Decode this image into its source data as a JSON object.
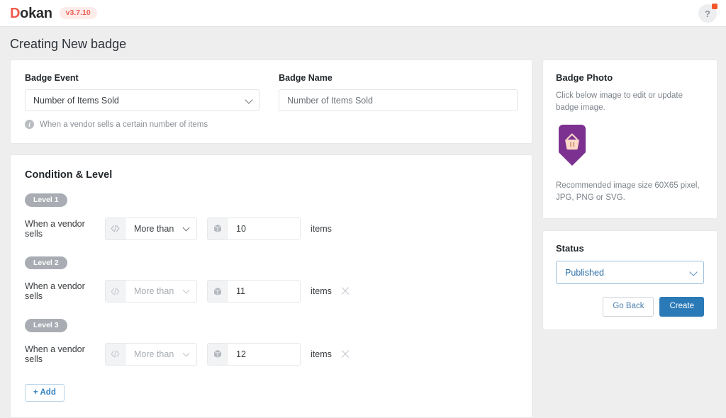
{
  "topbar": {
    "logo_d": "D",
    "logo_rest": "okan",
    "version": "v3.7.10",
    "help_label": "?"
  },
  "page": {
    "title": "Creating New badge"
  },
  "badge_info": {
    "event_label": "Badge Event",
    "event_value": "Number of Items Sold",
    "event_hint": "When a vendor sells a certain number of items",
    "name_label": "Badge Name",
    "name_value": "Number of Items Sold",
    "name_placeholder": "Number of Items Sold"
  },
  "condition": {
    "title": "Condition & Level",
    "add_label": "+ Add",
    "rows": [
      {
        "level": "Level 1",
        "prefix_text": "When a vendor sells",
        "operator": "More than",
        "amount": "10",
        "suffix_text": "items",
        "removable": false,
        "muted": false
      },
      {
        "level": "Level 2",
        "prefix_text": "When a vendor sells",
        "operator": "More than",
        "amount": "11",
        "suffix_text": "items",
        "removable": true,
        "muted": true
      },
      {
        "level": "Level 3",
        "prefix_text": "When a vendor sells",
        "operator": "More than",
        "amount": "12",
        "suffix_text": "items",
        "removable": true,
        "muted": true
      }
    ]
  },
  "badge_photo": {
    "title": "Badge Photo",
    "description": "Click below image to edit or update badge image.",
    "recommendation": "Recommended image size 60X65 pixel, JPG, PNG or SVG.",
    "art_color": "#7c3190",
    "art_icon_color": "#fbd9c8"
  },
  "status": {
    "title": "Status",
    "value": "Published",
    "go_back_label": "Go Back",
    "create_label": "Create",
    "accent_color": "#2b7ab8"
  }
}
